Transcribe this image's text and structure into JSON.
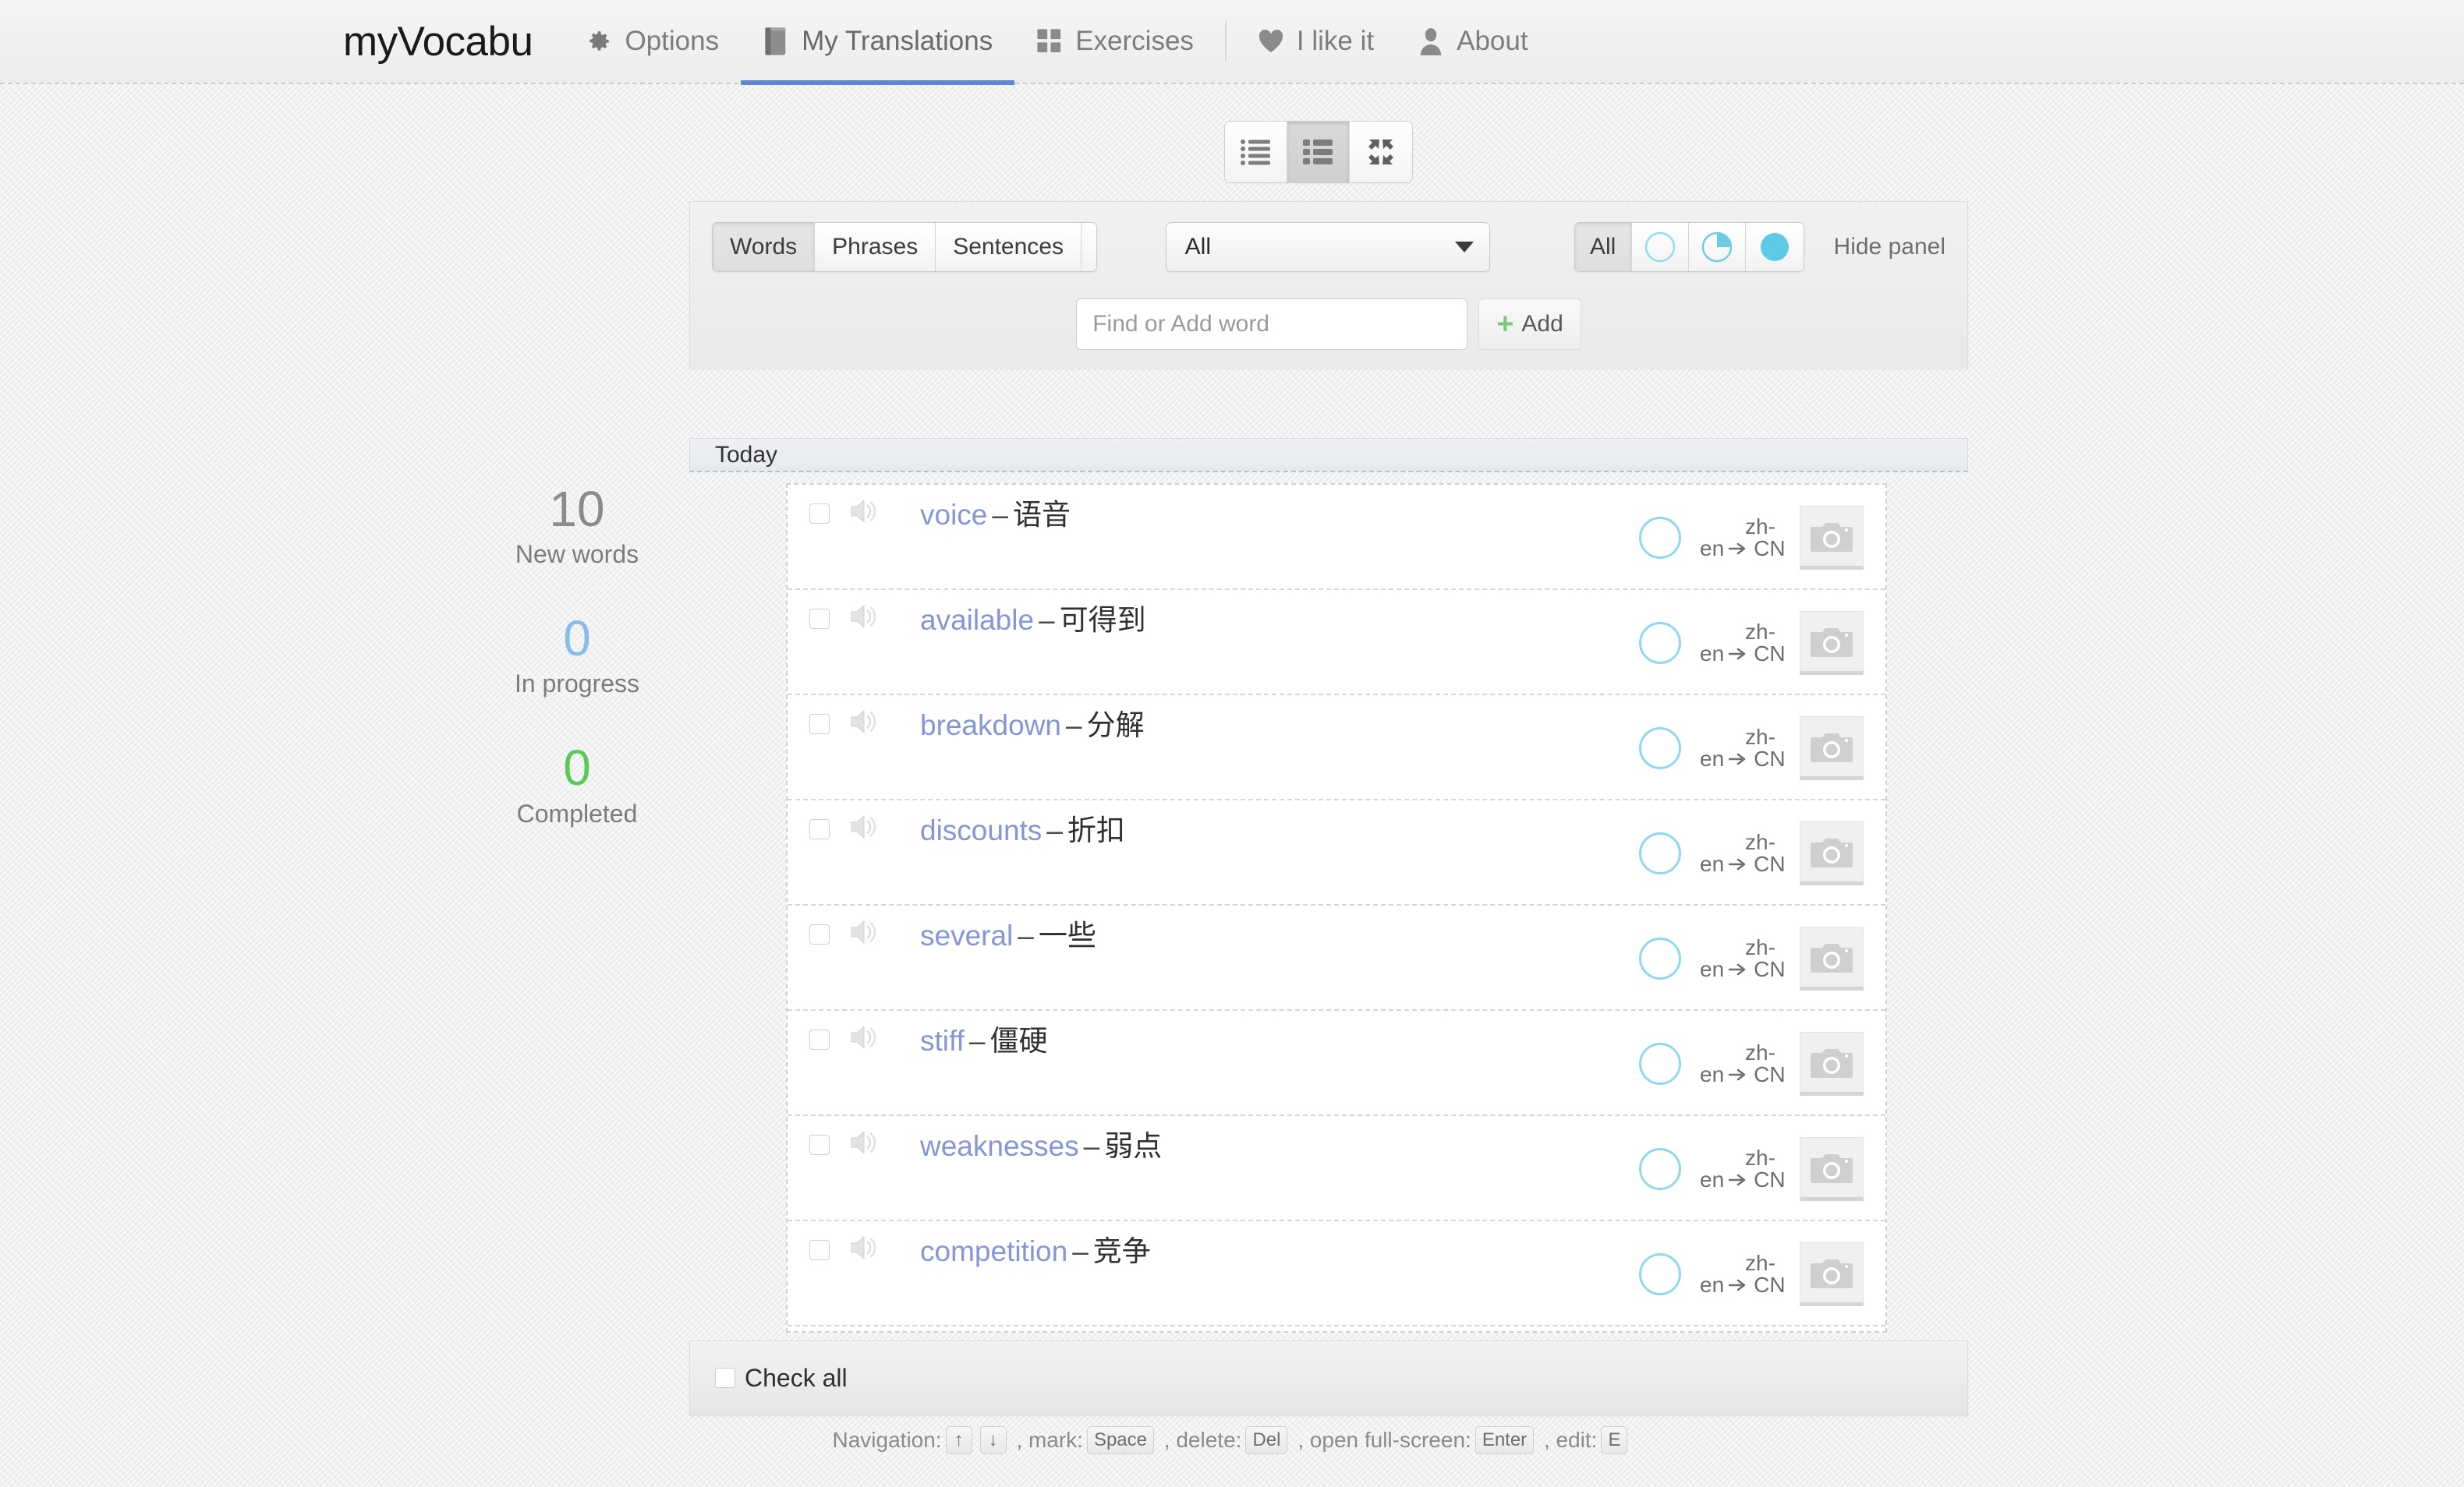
{
  "brand": "myVocabu",
  "nav": {
    "items": [
      {
        "label": "Options",
        "icon": "gear-icon",
        "active": false
      },
      {
        "label": "My Translations",
        "icon": "book-icon",
        "active": true
      },
      {
        "label": "Exercises",
        "icon": "grid-icon",
        "active": false
      },
      {
        "label": "I like it",
        "icon": "heart-icon",
        "active": false
      },
      {
        "label": "About",
        "icon": "user-icon",
        "active": false
      }
    ]
  },
  "view_toggle": {
    "buttons": [
      {
        "name": "list-view",
        "icon": "list-view-icon",
        "active": false
      },
      {
        "name": "card-view",
        "icon": "card-view-icon",
        "active": true
      },
      {
        "name": "fullscreen-view",
        "icon": "fullscreen-icon",
        "active": false
      }
    ]
  },
  "panel": {
    "type_filter": {
      "options": [
        "Words",
        "Phrases",
        "Sentences",
        "All"
      ],
      "selected": "Words"
    },
    "dictionary_select": {
      "value": "All",
      "options": [
        "All"
      ]
    },
    "status_filter": {
      "all_label": "All",
      "selected": "All",
      "icons": [
        "empty-circle-icon",
        "partial-circle-icon",
        "full-circle-icon"
      ]
    },
    "hide_panel_label": "Hide panel",
    "search": {
      "placeholder": "Find or Add word",
      "value": ""
    },
    "add_button_label": "Add"
  },
  "group_header": "Today",
  "words": [
    {
      "word": "voice",
      "dash": "–",
      "translation": "语音",
      "source_lang": "en",
      "target_lang": "zh-CN",
      "checked": false
    },
    {
      "word": "available",
      "dash": "–",
      "translation": "可得到",
      "source_lang": "en",
      "target_lang": "zh-CN",
      "checked": false
    },
    {
      "word": "breakdown",
      "dash": "–",
      "translation": "分解",
      "source_lang": "en",
      "target_lang": "zh-CN",
      "checked": false
    },
    {
      "word": "discounts",
      "dash": "–",
      "translation": "折扣",
      "source_lang": "en",
      "target_lang": "zh-CN",
      "checked": false
    },
    {
      "word": "several",
      "dash": "–",
      "translation": "一些",
      "source_lang": "en",
      "target_lang": "zh-CN",
      "checked": false
    },
    {
      "word": "stiff",
      "dash": "–",
      "translation": "僵硬",
      "source_lang": "en",
      "target_lang": "zh-CN",
      "checked": false
    },
    {
      "word": "weaknesses",
      "dash": "–",
      "translation": "弱点",
      "source_lang": "en",
      "target_lang": "zh-CN",
      "checked": false
    },
    {
      "word": "competition",
      "dash": "–",
      "translation": "竞争",
      "source_lang": "en",
      "target_lang": "zh-CN",
      "checked": false
    }
  ],
  "check_all_label": "Check all",
  "stats": [
    {
      "value": "10",
      "caption": "New words",
      "color": "#8b8b8b"
    },
    {
      "value": "0",
      "caption": "In progress",
      "color": "#86bdea"
    },
    {
      "value": "0",
      "caption": "Completed",
      "color": "#5bc85b"
    }
  ],
  "hints": {
    "navigation_label": "Navigation:",
    "key_up": "↑",
    "key_down": "↓",
    "mark_label": ", mark:",
    "key_space": "Space",
    "delete_label": ", delete:",
    "key_del": "Del",
    "fullscreen_label": ", open full-screen:",
    "key_enter": "Enter",
    "edit_label": ", edit:",
    "key_e": "E"
  },
  "colors": {
    "accent_blue": "#5b87d6",
    "word_link": "#8496d6",
    "progress_ring": "#8fd8f2",
    "status_cyan": "#5ec8e8",
    "green": "#5bc85b",
    "add_green": "#7fc97f"
  }
}
